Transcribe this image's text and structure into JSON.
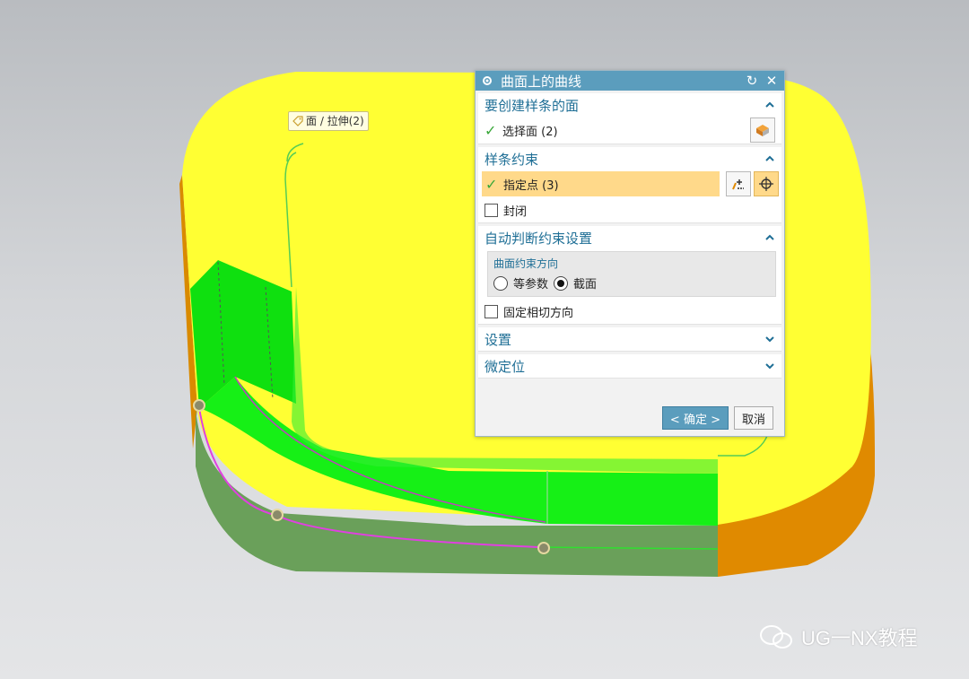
{
  "dialog": {
    "title": "曲面上的曲线",
    "sections": {
      "faces": {
        "title": "要创建样条的面",
        "select_label": "选择面 (2)"
      },
      "constraints": {
        "title": "样条约束",
        "point_label": "指定点 (3)",
        "closed_label": "封闭"
      },
      "auto": {
        "title": "自动判断约束设置",
        "group_title": "曲面约束方向",
        "radio_iso": "等参数",
        "radio_section": "截面",
        "fixed_tangent_label": "固定相切方向"
      },
      "settings": {
        "title": "设置"
      },
      "fine": {
        "title": "微定位"
      }
    },
    "ok_label": "< 确定 >",
    "cancel_label": "取消"
  },
  "viewport": {
    "tag_label": "面 / 拉伸(2)",
    "colors": {
      "top_face": "#ffff33",
      "side_orange": "#e08a00",
      "green_face": "#16e016",
      "green_side": "#6aa05a",
      "curve": "#e040e0"
    }
  },
  "watermark": {
    "text": "UG一NX教程"
  }
}
